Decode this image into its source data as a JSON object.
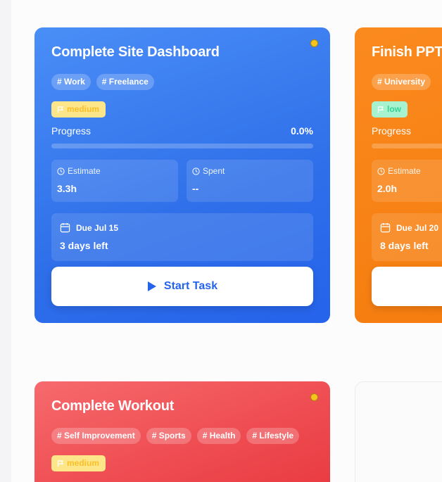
{
  "cards": [
    {
      "title": "Complete Site Dashboard",
      "tags": [
        "# Work",
        "# Freelance"
      ],
      "priority": "medium",
      "progress_label": "Progress",
      "progress_text": "0.0%",
      "progress_fraction": 0.0,
      "estimate_label": "Estimate",
      "estimate_value": "3.3h",
      "spent_label": "Spent",
      "spent_value": "--",
      "due_date": "Due Jul 15",
      "due_left": "3 days left",
      "button_label": "Start Task",
      "color": "#3b82f6"
    },
    {
      "title": "Finish PPT",
      "tags": [
        "# University"
      ],
      "priority": "low",
      "progress_label": "Progress",
      "estimate_label": "Estimate",
      "estimate_value": "2.0h",
      "due_date": "Due Jul 20",
      "due_left": "8 days left",
      "color": "#f97316"
    },
    {
      "title": "Complete Workout",
      "tags": [
        "# Self Improvement",
        "# Sports",
        "# Health",
        "# Lifestyle"
      ],
      "priority": "medium",
      "color": "#ef4444"
    }
  ],
  "status_dot_color": "#facc15",
  "icons": {
    "flag": "flag-icon",
    "clock": "clock-icon",
    "calendar": "calendar-icon",
    "play": "play-icon"
  }
}
